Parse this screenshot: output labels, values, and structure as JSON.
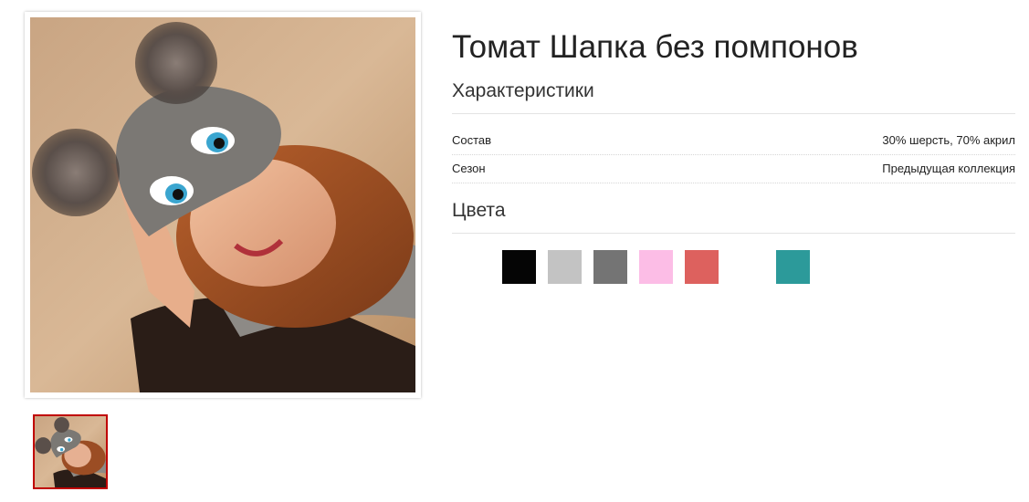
{
  "product": {
    "title": "Томат Шапка без помпонов",
    "photo_alt": "Томат Шапка без помпонов"
  },
  "characteristics": {
    "heading": "Характеристики",
    "rows": [
      {
        "label": "Состав",
        "value": "30% шерсть, 70% акрил"
      },
      {
        "label": "Сезон",
        "value": "Предыдущая коллекция"
      }
    ]
  },
  "colors": {
    "heading": "Цвета",
    "swatches": [
      {
        "name": "white",
        "hex": "#ffffff"
      },
      {
        "name": "black",
        "hex": "#050505"
      },
      {
        "name": "light-gray",
        "hex": "#c3c3c3"
      },
      {
        "name": "dark-gray",
        "hex": "#747474"
      },
      {
        "name": "pink",
        "hex": "#fcbde6"
      },
      {
        "name": "coral",
        "hex": "#dd615e"
      },
      {
        "name": "white",
        "hex": "#ffffff"
      },
      {
        "name": "teal",
        "hex": "#2c9a9a"
      }
    ]
  },
  "gallery": {
    "selected_border_color": "#c00000",
    "thumbnails": 1
  }
}
